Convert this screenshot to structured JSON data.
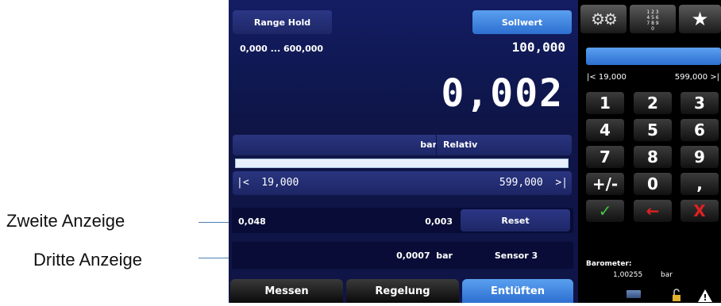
{
  "annotations": {
    "second_display": "Zweite Anzeige",
    "third_display": "Dritte Anzeige"
  },
  "header": {
    "range_hold": "Range Hold",
    "setpoint_label": "Sollwert",
    "range_text": "0,000 ... 600,000",
    "setpoint_value": "100,000"
  },
  "main_value": "0,002",
  "unit_row": {
    "unit": "bar",
    "mode": "Relativ"
  },
  "limits": {
    "low": "|<  19,000",
    "high": "599,000  >|"
  },
  "second_display": {
    "value_a": "0,048",
    "value_b": "0,003",
    "reset": "Reset"
  },
  "third_display": {
    "value": "0,0007  bar",
    "sensor": "Sensor 3"
  },
  "tabs": [
    "Messen",
    "Regelung",
    "Entlüften"
  ],
  "keypad": {
    "input_limits": {
      "low": "|< 19,000",
      "high": "599,000 >|"
    },
    "keys": [
      "1",
      "2",
      "3",
      "4",
      "5",
      "6",
      "7",
      "8",
      "9",
      "+/-",
      "0",
      ","
    ],
    "confirm": "✓",
    "backspace": "←",
    "cancel": "X",
    "numpad_icon_text": "1 2 3\n4 5 6\n7 8 9\n0"
  },
  "barometer": {
    "label": "Barometer:",
    "value": "1,00255",
    "unit": "bar"
  },
  "colors": {
    "accent_blue": "#3d86e6",
    "background_dark": "#0f1546",
    "confirm_green": "#44c544",
    "cancel_red": "#e02020"
  }
}
